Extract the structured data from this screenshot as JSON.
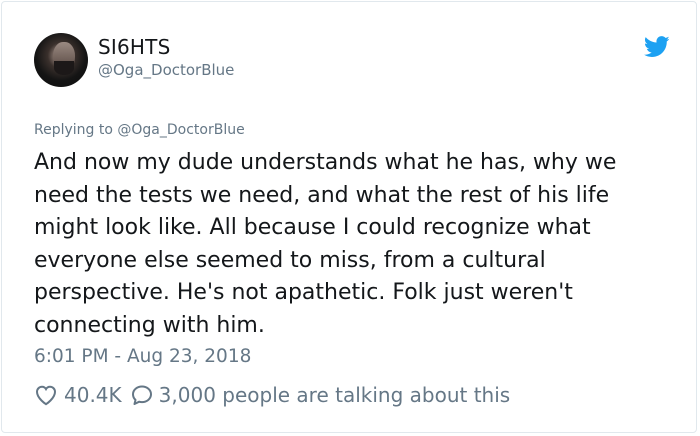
{
  "author": {
    "display_name": "SI6HTS",
    "handle": "@Oga_DoctorBlue"
  },
  "tweet": {
    "replying_to": "Replying to @Oga_DoctorBlue",
    "lines": [
      "And now my dude understands what he has, why we",
      "need the tests we need, and what the rest of his life",
      "might look like. All because I could recognize what",
      "everyone else seemed to miss, from a cultural",
      "perspective. He's not apathetic. Folk just weren't",
      "connecting with him."
    ],
    "timestamp": "6:01 PM - Aug 23, 2018",
    "likes": "40.4K",
    "talking": "3,000 people are talking about this"
  },
  "icons": {
    "brand": "twitter-bird-icon",
    "like": "heart-icon",
    "reply": "speech-bubble-icon"
  },
  "colors": {
    "brand": "#1da1f2",
    "text": "#14171a",
    "muted": "#657786",
    "border": "#e1e8ed"
  }
}
